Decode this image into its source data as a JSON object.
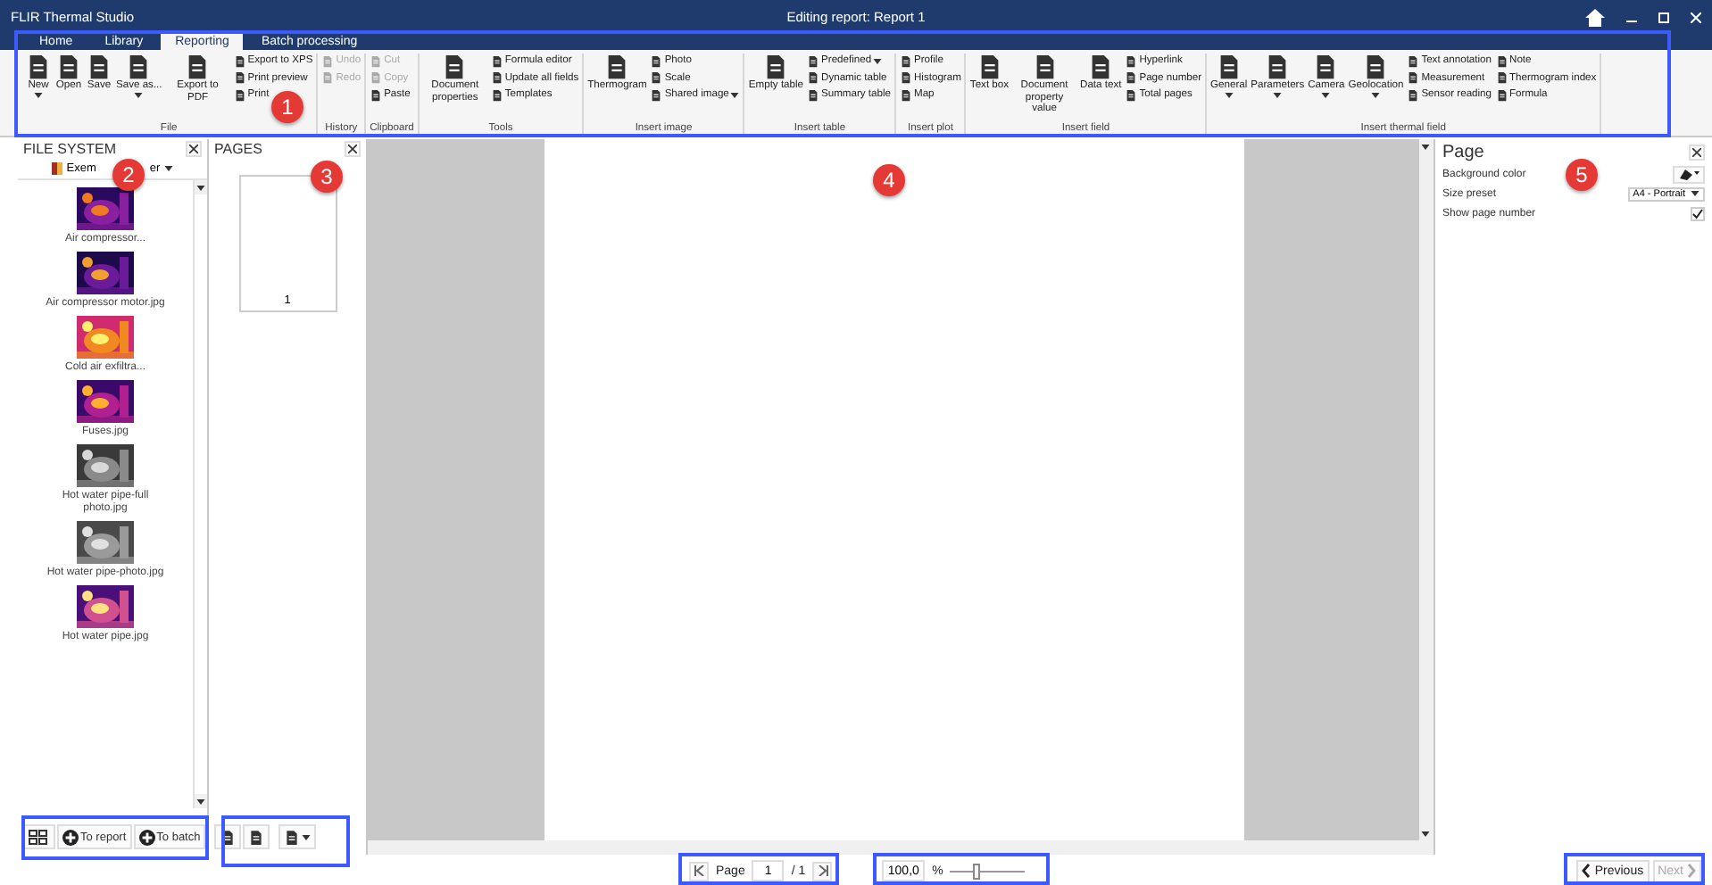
{
  "window": {
    "app_name": "FLIR Thermal Studio",
    "title": "Editing report: Report 1"
  },
  "tabs": [
    {
      "label": "Home",
      "selected": false
    },
    {
      "label": "Library",
      "selected": false
    },
    {
      "label": "Reporting",
      "selected": true
    },
    {
      "label": "Batch processing",
      "selected": false
    }
  ],
  "ribbon": [
    {
      "label": "File",
      "columns": [
        {
          "kind": "large",
          "items": [
            {
              "label": "New",
              "has_menu": true,
              "disabled": false
            }
          ]
        },
        {
          "kind": "large",
          "items": [
            {
              "label": "Open",
              "has_menu": false,
              "disabled": false
            }
          ]
        },
        {
          "kind": "large",
          "items": [
            {
              "label": "Save",
              "has_menu": false,
              "disabled": false
            }
          ]
        },
        {
          "kind": "large",
          "items": [
            {
              "label": "Save as...",
              "has_menu": true,
              "disabled": false
            }
          ]
        },
        {
          "kind": "large",
          "items": [
            {
              "label": "Export to PDF",
              "has_menu": false,
              "disabled": false
            }
          ]
        },
        {
          "kind": "small",
          "items": [
            {
              "label": "Export to XPS",
              "has_menu": false,
              "disabled": false
            },
            {
              "label": "Print preview",
              "has_menu": false,
              "disabled": false
            },
            {
              "label": "Print",
              "has_menu": false,
              "disabled": false
            }
          ]
        }
      ]
    },
    {
      "label": "History",
      "columns": [
        {
          "kind": "small",
          "items": [
            {
              "label": "Undo",
              "has_menu": false,
              "disabled": true
            },
            {
              "label": "Redo",
              "has_menu": false,
              "disabled": true
            }
          ]
        }
      ]
    },
    {
      "label": "Clipboard",
      "columns": [
        {
          "kind": "small",
          "items": [
            {
              "label": "Cut",
              "has_menu": false,
              "disabled": true
            },
            {
              "label": "Copy",
              "has_menu": false,
              "disabled": true
            },
            {
              "label": "Paste",
              "has_menu": false,
              "disabled": false
            }
          ]
        }
      ]
    },
    {
      "label": "Tools",
      "columns": [
        {
          "kind": "large",
          "items": [
            {
              "label": "Document properties",
              "has_menu": false,
              "disabled": false
            }
          ]
        },
        {
          "kind": "small",
          "items": [
            {
              "label": "Formula editor",
              "has_menu": false,
              "disabled": false
            },
            {
              "label": "Update all fields",
              "has_menu": false,
              "disabled": false
            },
            {
              "label": "Templates",
              "has_menu": false,
              "disabled": false
            }
          ]
        }
      ]
    },
    {
      "label": "Insert image",
      "columns": [
        {
          "kind": "large",
          "items": [
            {
              "label": "Thermogram",
              "has_menu": false,
              "disabled": false
            }
          ]
        },
        {
          "kind": "small",
          "items": [
            {
              "label": "Photo",
              "has_menu": false,
              "disabled": false
            },
            {
              "label": "Scale",
              "has_menu": false,
              "disabled": false
            },
            {
              "label": "Shared image",
              "has_menu": true,
              "disabled": false
            }
          ]
        }
      ]
    },
    {
      "label": "Insert table",
      "columns": [
        {
          "kind": "large",
          "items": [
            {
              "label": "Empty table",
              "has_menu": false,
              "disabled": false
            }
          ]
        },
        {
          "kind": "small",
          "items": [
            {
              "label": "Predefined",
              "has_menu": true,
              "disabled": false
            },
            {
              "label": "Dynamic table",
              "has_menu": false,
              "disabled": false
            },
            {
              "label": "Summary table",
              "has_menu": false,
              "disabled": false
            }
          ]
        }
      ]
    },
    {
      "label": "Insert plot",
      "columns": [
        {
          "kind": "small",
          "items": [
            {
              "label": "Profile",
              "has_menu": false,
              "disabled": false
            },
            {
              "label": "Histogram",
              "has_menu": false,
              "disabled": false
            },
            {
              "label": "Map",
              "has_menu": false,
              "disabled": false
            }
          ]
        }
      ]
    },
    {
      "label": "Insert field",
      "columns": [
        {
          "kind": "large",
          "items": [
            {
              "label": "Text box",
              "has_menu": false,
              "disabled": false
            }
          ]
        },
        {
          "kind": "large",
          "items": [
            {
              "label": "Document property value",
              "has_menu": false,
              "disabled": false
            }
          ]
        },
        {
          "kind": "large",
          "items": [
            {
              "label": "Data text",
              "has_menu": false,
              "disabled": false
            }
          ]
        },
        {
          "kind": "small",
          "items": [
            {
              "label": "Hyperlink",
              "has_menu": false,
              "disabled": false
            },
            {
              "label": "Page number",
              "has_menu": false,
              "disabled": false
            },
            {
              "label": "Total pages",
              "has_menu": false,
              "disabled": false
            }
          ]
        }
      ]
    },
    {
      "label": "Insert thermal field",
      "columns": [
        {
          "kind": "large",
          "items": [
            {
              "label": "General",
              "has_menu": true,
              "disabled": false
            }
          ]
        },
        {
          "kind": "large",
          "items": [
            {
              "label": "Parameters",
              "has_menu": true,
              "disabled": false
            }
          ]
        },
        {
          "kind": "large",
          "items": [
            {
              "label": "Camera",
              "has_menu": true,
              "disabled": false
            }
          ]
        },
        {
          "kind": "large",
          "items": [
            {
              "label": "Geolocation",
              "has_menu": true,
              "disabled": false
            }
          ]
        },
        {
          "kind": "small",
          "items": [
            {
              "label": "Text annotation",
              "has_menu": false,
              "disabled": false
            },
            {
              "label": "Measurement",
              "has_menu": false,
              "disabled": false
            },
            {
              "label": "Sensor reading",
              "has_menu": false,
              "disabled": false
            }
          ]
        },
        {
          "kind": "small",
          "items": [
            {
              "label": "Note",
              "has_menu": false,
              "disabled": false
            },
            {
              "label": "Thermogram index",
              "has_menu": false,
              "disabled": false
            },
            {
              "label": "Formula",
              "has_menu": false,
              "disabled": false
            }
          ]
        }
      ]
    }
  ],
  "file_system": {
    "title": "FILE SYSTEM",
    "folder_parts": [
      "Exem",
      "er"
    ],
    "files": [
      {
        "name": "Air compressor..."
      },
      {
        "name": "Air compressor motor.jpg"
      },
      {
        "name": "Cold air exfiltra..."
      },
      {
        "name": "Fuses.jpg"
      },
      {
        "name": "Hot water pipe-full photo.jpg"
      },
      {
        "name": "Hot water pipe-photo.jpg"
      },
      {
        "name": "Hot water pipe.jpg"
      }
    ],
    "buttons": [
      "To report",
      "To batch"
    ]
  },
  "pages": {
    "title": "PAGES",
    "thumbnails": [
      {
        "number": "1",
        "selected": false
      }
    ]
  },
  "properties": {
    "title": "Page",
    "rows": [
      {
        "label": "Background color",
        "kind": "color"
      },
      {
        "label": "Size preset",
        "kind": "dropdown",
        "value": "A4 - Portrait"
      },
      {
        "label": "Show page number",
        "kind": "checkbox",
        "checked": true
      }
    ]
  },
  "page_navigation": {
    "label": "Page",
    "value": "1",
    "total": "/ 1"
  },
  "zoom": {
    "value": "100,0",
    "unit": "%",
    "level": 0.3
  },
  "nav_buttons": [
    {
      "label": "Previous",
      "disabled": false
    },
    {
      "label": "Next",
      "disabled": true
    }
  ],
  "annotation_markers": [
    "1",
    "2",
    "3",
    "4",
    "5"
  ]
}
